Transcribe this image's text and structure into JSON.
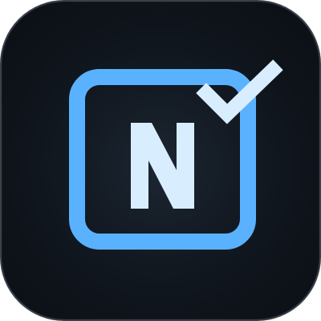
{
  "app_icon": {
    "letter": "N",
    "icons": [
      "notes-app-icon",
      "checkmark-icon",
      "rounded-frame-icon"
    ],
    "colors": {
      "background_center": "#1c2633",
      "background_edge": "#0b0f14",
      "frame": "#5ab2ff",
      "letter": "#d8eeff",
      "checkmark": "#d8eeff",
      "border": "#3a4048"
    }
  }
}
